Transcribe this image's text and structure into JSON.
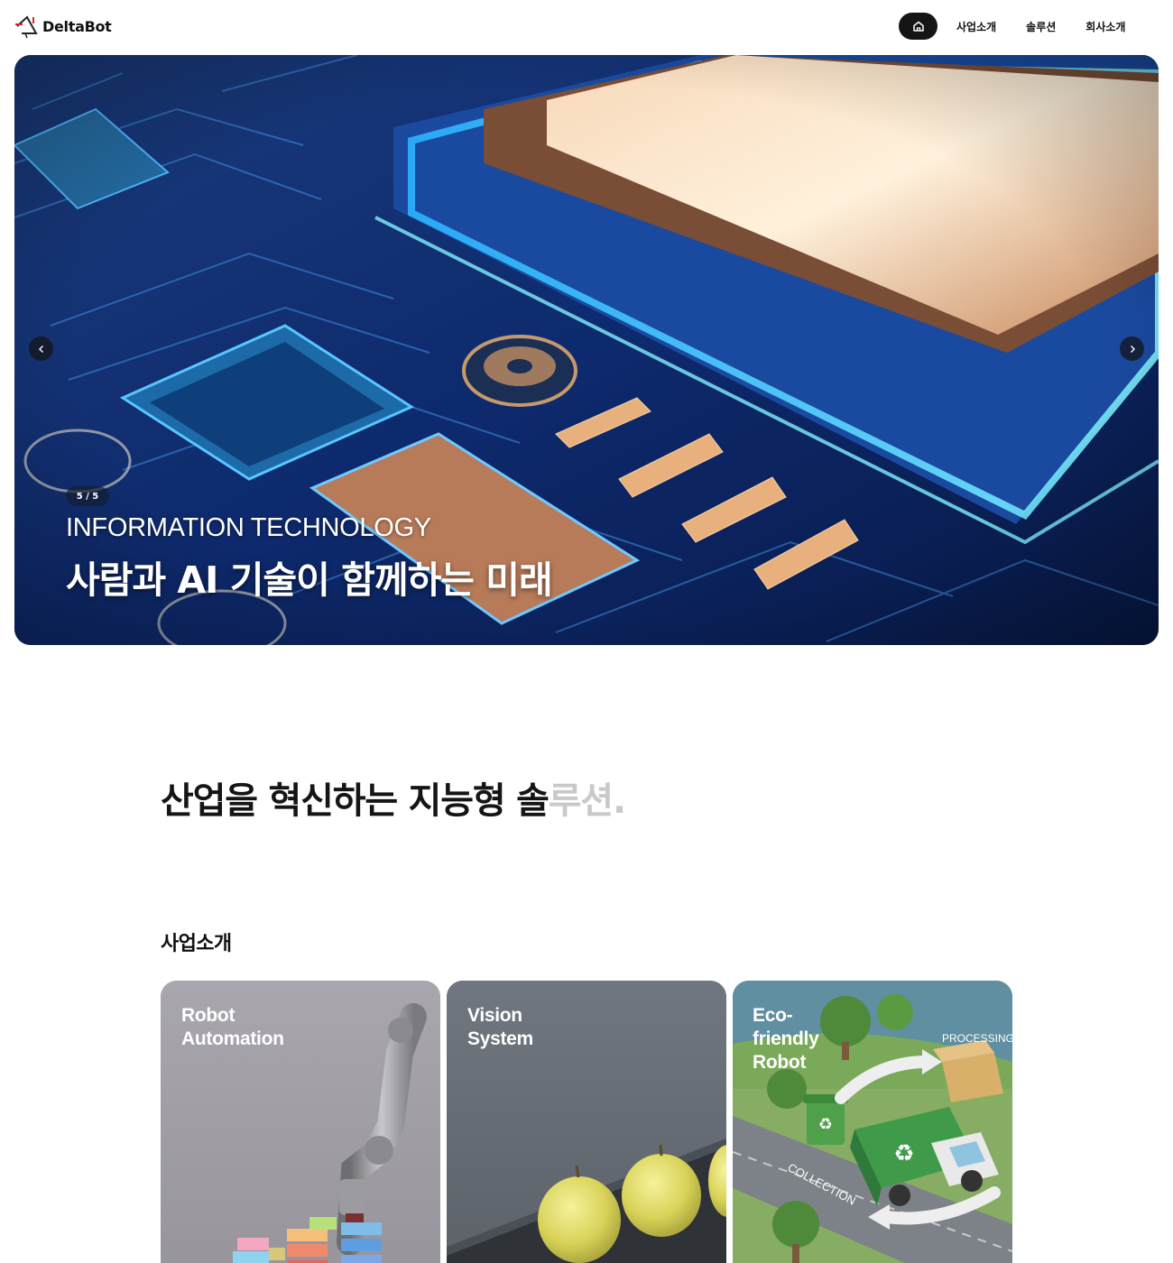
{
  "header": {
    "brand": "DeltaBot",
    "nav": {
      "home_icon": "home-icon",
      "items": [
        {
          "label": "사업소개"
        },
        {
          "label": "솔루션"
        },
        {
          "label": "회사소개"
        }
      ]
    }
  },
  "hero": {
    "counter": "5 / 5",
    "subtitle": "INFORMATION TECHNOLOGY",
    "title": "사람과 AI 기술이 함께하는 미래",
    "prev_icon": "chevron-left-icon",
    "next_icon": "chevron-right-icon"
  },
  "tagline": {
    "dark": "산업을 혁신하는 지능형 솔",
    "light": "루션."
  },
  "business": {
    "title": "사업소개",
    "cards": [
      {
        "title": "Robot\nAutomation"
      },
      {
        "title": "Vision\nSystem"
      },
      {
        "title": "Eco-\nfriendly\nRobot",
        "labels": [
          "PROCESSING",
          "COLLECTION"
        ]
      }
    ]
  },
  "colors": {
    "nav_active_bg": "#151515",
    "tagline_light": "#c9c9c9",
    "logo_accent": "#d6262b"
  }
}
